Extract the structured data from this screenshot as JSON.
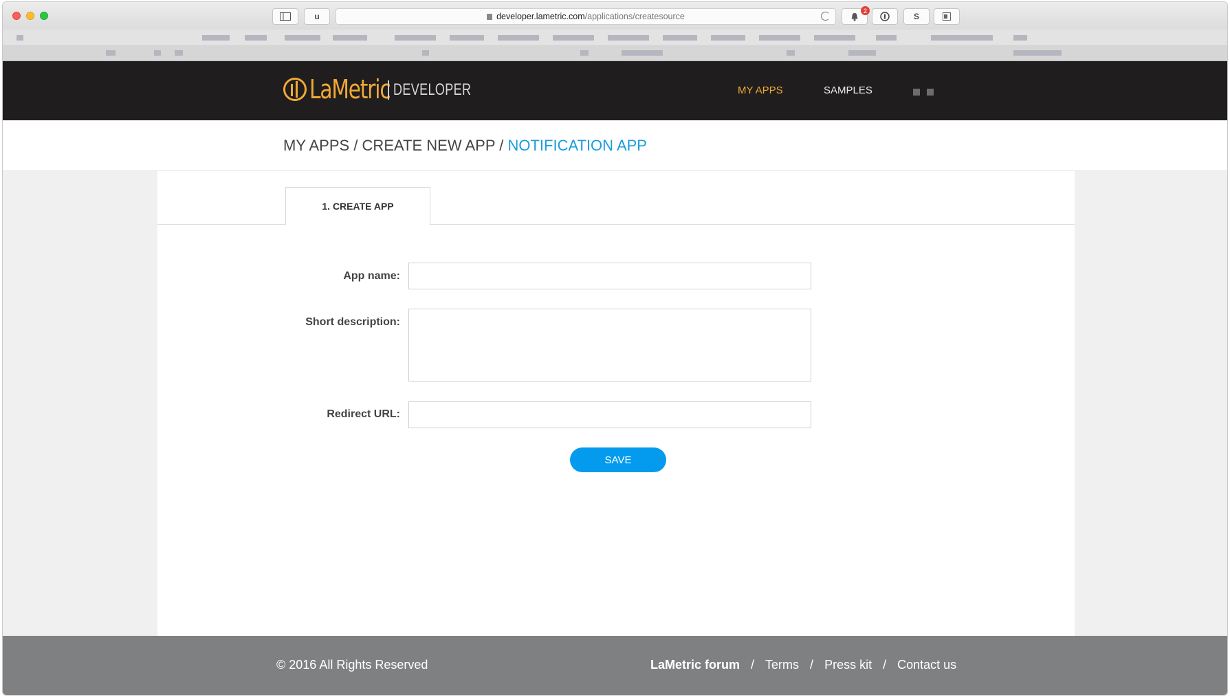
{
  "browser": {
    "url_host": "developer.lametric.com",
    "url_path": "/applications/createsource",
    "toolbar_u_label": "u",
    "extension_badge": "2",
    "extension_s_label": "S"
  },
  "header": {
    "logo_text": "LaMetric",
    "logo_sub": "DEVELOPER",
    "nav": {
      "my_apps": "MY APPS",
      "samples": "SAMPLES"
    }
  },
  "breadcrumb": {
    "items": [
      "MY APPS",
      "CREATE NEW APP"
    ],
    "separator": " / ",
    "current": "NOTIFICATION APP"
  },
  "tabs": [
    {
      "label": "1. CREATE APP",
      "active": true
    }
  ],
  "form": {
    "app_name_label": "App name:",
    "app_name_value": "",
    "short_description_label": "Short description:",
    "short_description_value": "",
    "redirect_url_label": "Redirect URL:",
    "redirect_url_value": "",
    "save_label": "SAVE"
  },
  "footer": {
    "copyright": "© 2016 All Rights Reserved",
    "links": {
      "forum": "LaMetric forum",
      "terms": "Terms",
      "press_kit": "Press kit",
      "contact": "Contact us"
    },
    "separator": "/"
  },
  "colors": {
    "accent_orange": "#f0a936",
    "link_blue": "#1a9ddb",
    "button_blue": "#049bef",
    "header_bg": "#1f1d1d",
    "footer_bg": "#7f8082"
  }
}
